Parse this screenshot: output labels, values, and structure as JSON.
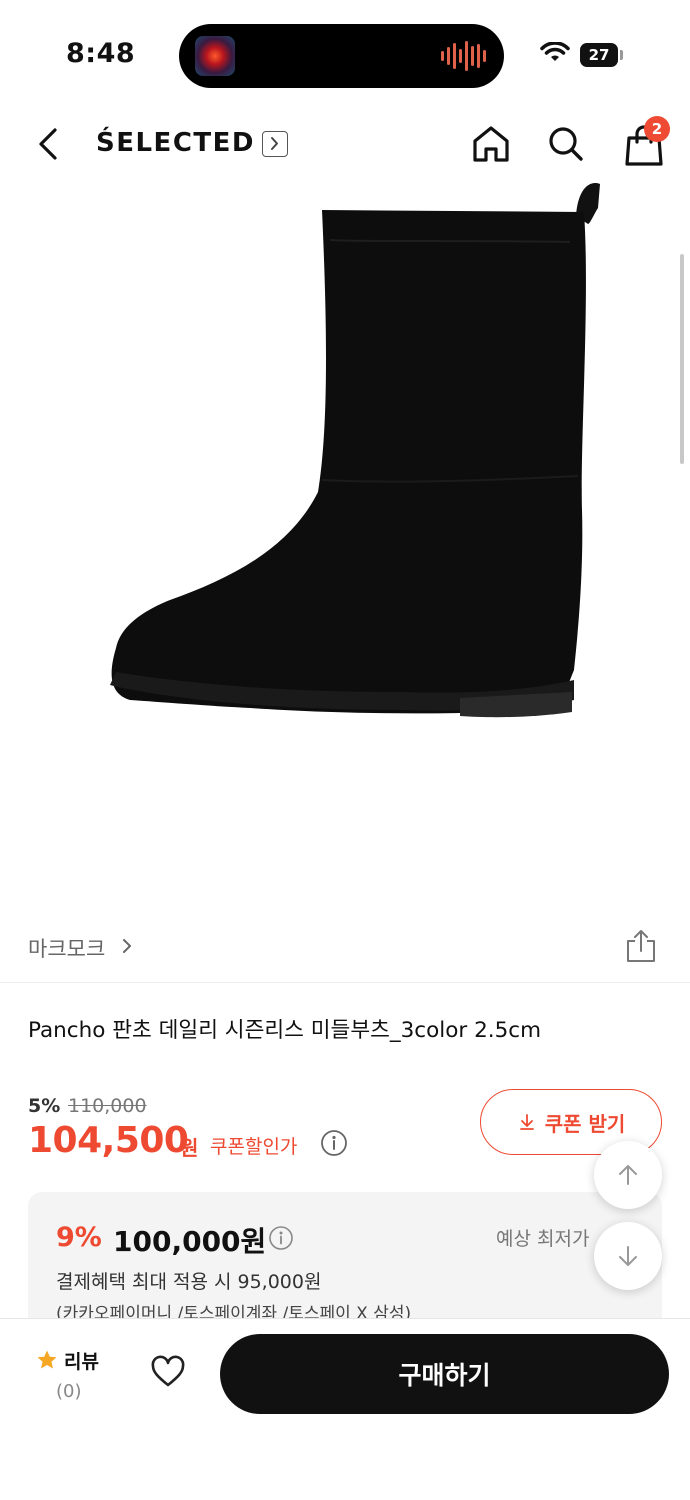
{
  "status_bar": {
    "time": "8:48",
    "battery": "27"
  },
  "nav": {
    "brand": "ŚELECTED",
    "cart_count": "2"
  },
  "product": {
    "brand_name": "마크모크",
    "title": "Pancho 판초 데일리 시즌리스 미들부츠_3color 2.5cm",
    "discount_rate": "5%",
    "original_price": "110,000",
    "sale_price": "104,500",
    "currency": "원",
    "coupon_discount_label": "쿠폰할인가",
    "coupon_button": "쿠폰 받기"
  },
  "benefit": {
    "rate": "9%",
    "price": "100,000원",
    "lowest_label": "예상 최저가",
    "line1": "결제혜택 최대 적용 시 95,000원",
    "line2": "(카카오페이머니 /토스페이계좌 /토스페이 X 삼성)"
  },
  "bottom": {
    "review_label": "리뷰",
    "review_count": "(0)",
    "buy_label": "구매하기"
  },
  "colors": {
    "accent": "#ee4a32",
    "dark": "#111111"
  }
}
